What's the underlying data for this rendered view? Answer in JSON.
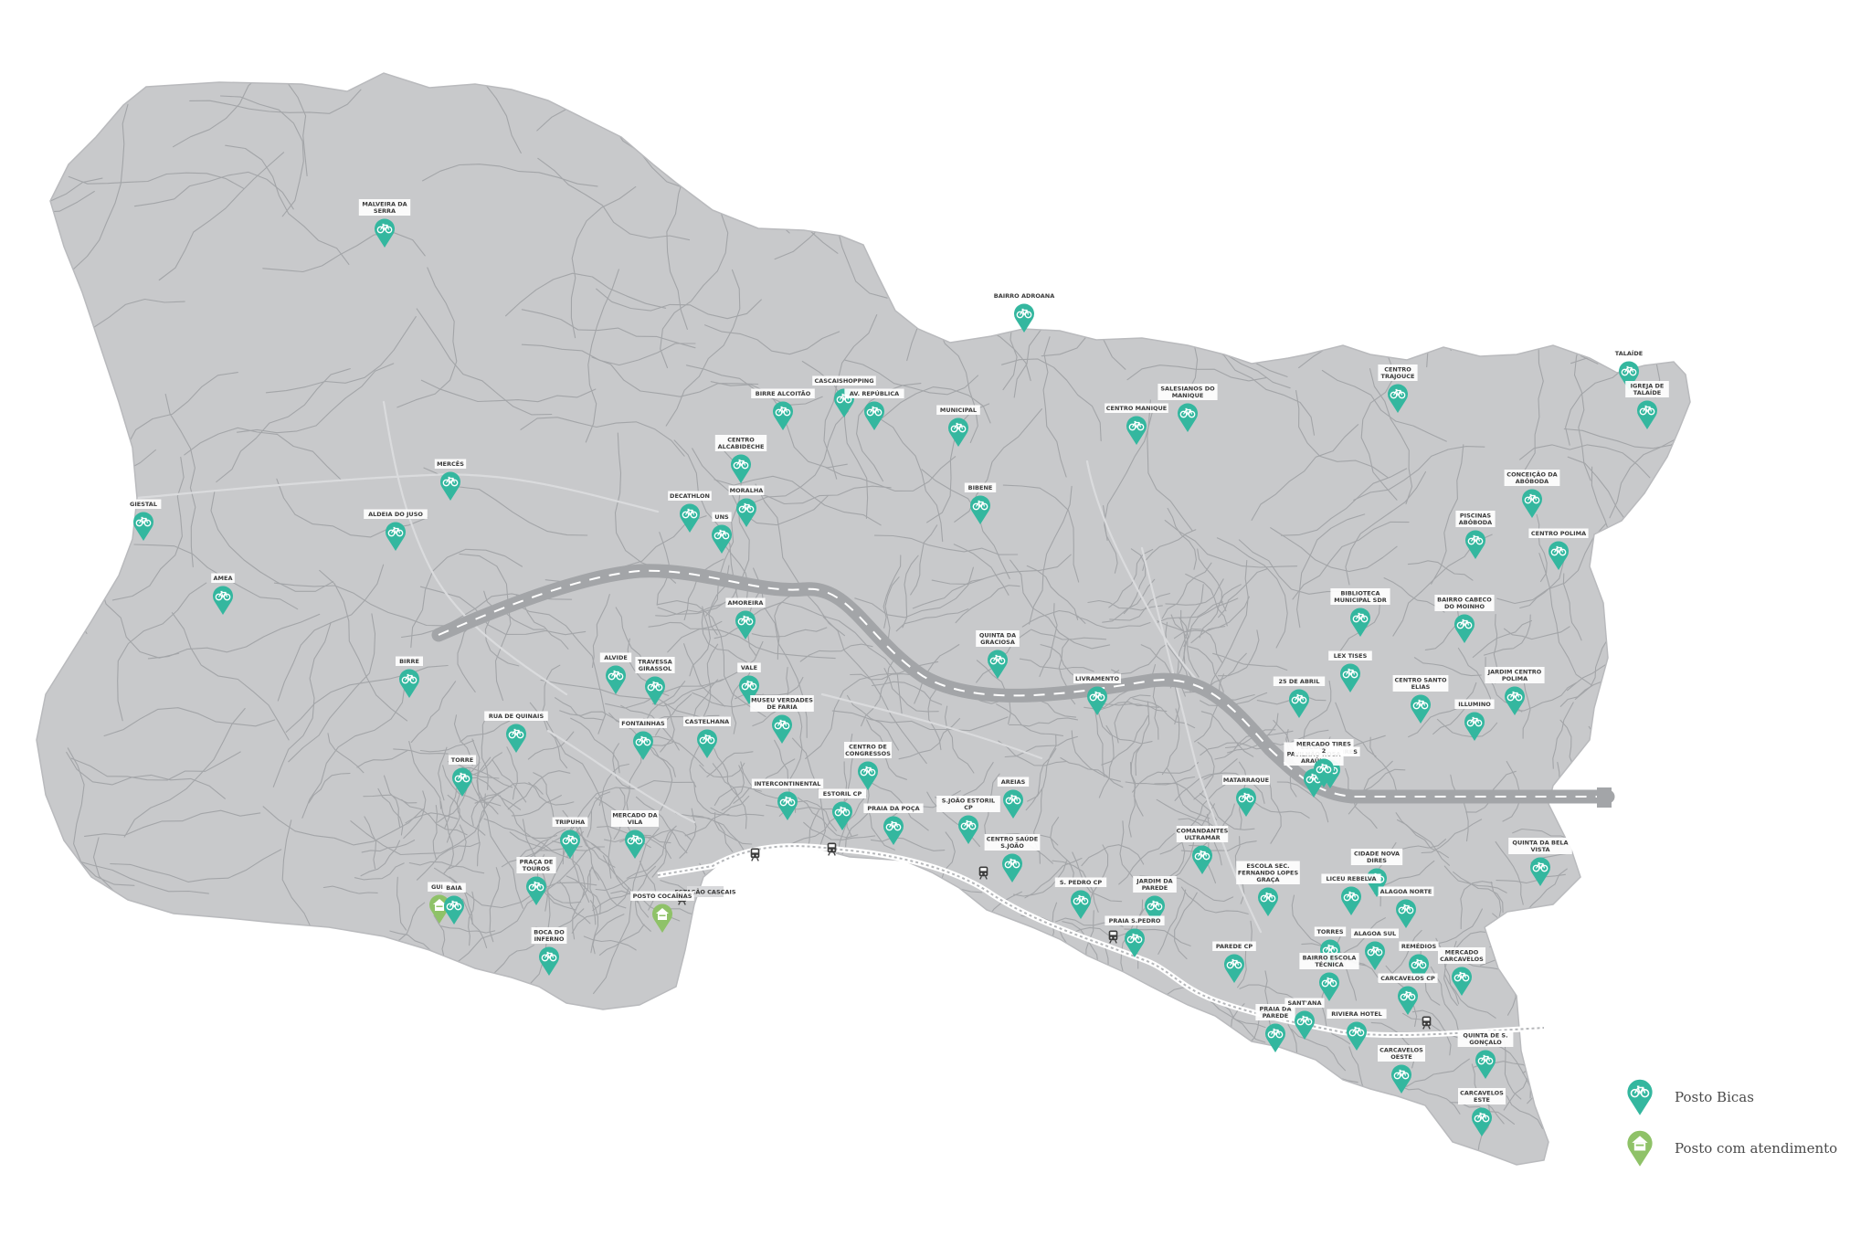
{
  "colors": {
    "land": "#c8c9cb",
    "roads": "#a3a5a8",
    "minor_roads": "#b2b4b7",
    "highway": "#9d9fa2",
    "highway_dash": "#ffffff",
    "bicas_pin": "#34b79f",
    "service_pin": "#8fc268",
    "background": "#ffffff"
  },
  "legend": {
    "bicas_label": "Posto Bicas",
    "bicas_icon": "bicycle-pin-icon",
    "service_label": "Posto com atendimento",
    "service_icon": "house-pin-icon"
  },
  "station_labels": {
    "cp": "ESTAÇÃO CASCAIS"
  },
  "stations": [
    {
      "name": "MALVEIRA DA SERRA",
      "type": "bicas"
    },
    {
      "name": "BAIRRO ADROANA",
      "type": "bicas"
    },
    {
      "name": "TALAÍDE",
      "type": "bicas"
    },
    {
      "name": "CENTRO TRAJOUCE",
      "type": "bicas"
    },
    {
      "name": "IGREJA DE TALAÍDE",
      "type": "bicas"
    },
    {
      "name": "CASCAISHOPPING",
      "type": "bicas"
    },
    {
      "name": "BIRRE ALCOITÃO",
      "type": "bicas"
    },
    {
      "name": "AV. REPÚBLICA",
      "type": "bicas"
    },
    {
      "name": "MUNICIPAL",
      "type": "bicas"
    },
    {
      "name": "CENTRO MANIQUE",
      "type": "bicas"
    },
    {
      "name": "SALESIANOS DO MANIQUE",
      "type": "bicas"
    },
    {
      "name": "CENTRO ALCABIDECHE",
      "type": "bicas"
    },
    {
      "name": "MERCÊS",
      "type": "bicas"
    },
    {
      "name": "CONCEIÇÃO DA ABÓBODA",
      "type": "bicas"
    },
    {
      "name": "GIESTAL",
      "type": "bicas"
    },
    {
      "name": "ALDEIA DO JUSO",
      "type": "bicas"
    },
    {
      "name": "DECATHLON",
      "type": "bicas"
    },
    {
      "name": "MORALHA",
      "type": "bicas"
    },
    {
      "name": "BIBENE",
      "type": "bicas"
    },
    {
      "name": "PISCINAS ABÓBODA",
      "type": "bicas"
    },
    {
      "name": "CENTRO POLIMA",
      "type": "bicas"
    },
    {
      "name": "UNS",
      "type": "bicas"
    },
    {
      "name": "AMEA",
      "type": "bicas"
    },
    {
      "name": "BIBLIOTECA MUNICIPAL SDR",
      "type": "bicas"
    },
    {
      "name": "BAIRRO CABECO DO MOINHO",
      "type": "bicas"
    },
    {
      "name": "AMOREIRA",
      "type": "bicas"
    },
    {
      "name": "QUINTA DA GRACIOSA",
      "type": "bicas"
    },
    {
      "name": "BIRRE",
      "type": "bicas"
    },
    {
      "name": "ALVIDE",
      "type": "bicas"
    },
    {
      "name": "TRAVESSA GIRASSOL",
      "type": "bicas"
    },
    {
      "name": "VALE",
      "type": "bicas"
    },
    {
      "name": "LIVRAMENTO",
      "type": "bicas"
    },
    {
      "name": "25 DE ABRIL",
      "type": "bicas"
    },
    {
      "name": "LEX TISES",
      "type": "bicas"
    },
    {
      "name": "CENTRO SANTO ELIAS",
      "type": "bicas"
    },
    {
      "name": "JARDIM CENTRO POLIMA",
      "type": "bicas"
    },
    {
      "name": "ILLUMINO",
      "type": "bicas"
    },
    {
      "name": "RUA DE QUINAIS",
      "type": "bicas"
    },
    {
      "name": "CASTELHANA",
      "type": "bicas"
    },
    {
      "name": "MUSEU VERDADES DE FARIA",
      "type": "bicas"
    },
    {
      "name": "FONTAINHAS",
      "type": "bicas"
    },
    {
      "name": "CENTRO DE CONGRESSOS",
      "type": "bicas"
    },
    {
      "name": "MERCADO TIRES",
      "type": "bicas"
    },
    {
      "name": "ESCOLA PAVILHÃO ROSA ARAÚJO",
      "type": "bicas"
    },
    {
      "name": "TORRE",
      "type": "bicas"
    },
    {
      "name": "AREIAS",
      "type": "bicas"
    },
    {
      "name": "MATARRAQUE",
      "type": "bicas"
    },
    {
      "name": "INTERCONTINENTAL",
      "type": "bicas"
    },
    {
      "name": "ESTORIL CP",
      "type": "bicas"
    },
    {
      "name": "PRAIA DA POÇA",
      "type": "bicas"
    },
    {
      "name": "S.JOÃO ESTORIL CP",
      "type": "bicas"
    },
    {
      "name": "TRIPUHA",
      "type": "bicas"
    },
    {
      "name": "MERCADO DA VILA",
      "type": "bicas"
    },
    {
      "name": "CENTRO SAÚDE S.JOÃO",
      "type": "bicas"
    },
    {
      "name": "COMANDANTES ULTRAMAR",
      "type": "bicas"
    },
    {
      "name": "QUINTA DA BELA VISTA",
      "type": "bicas"
    },
    {
      "name": "CIDADE NOVA DIRES",
      "type": "bicas"
    },
    {
      "name": "PRAÇA DE TOUROS",
      "type": "bicas"
    },
    {
      "name": "GUIA",
      "type": "service"
    },
    {
      "name": "POSTO COCAÍNAS",
      "type": "service"
    },
    {
      "name": "BAIA",
      "type": "bicas"
    },
    {
      "name": "S. PEDRO CP",
      "type": "bicas"
    },
    {
      "name": "JARDIM DA PAREDE",
      "type": "bicas"
    },
    {
      "name": "ESCOLA SEC. FERNANDO LOPES GRAÇA",
      "type": "bicas"
    },
    {
      "name": "LICEU REBELVA",
      "type": "bicas"
    },
    {
      "name": "ALAGOA NORTE",
      "type": "bicas"
    },
    {
      "name": "BOCA DO INFERNO",
      "type": "bicas"
    },
    {
      "name": "PRAIA S.PEDRO",
      "type": "bicas"
    },
    {
      "name": "PAREDE CP",
      "type": "bicas"
    },
    {
      "name": "TORRES",
      "type": "bicas"
    },
    {
      "name": "ALAGOA SUL",
      "type": "bicas"
    },
    {
      "name": "REMÉDIOS",
      "type": "bicas"
    },
    {
      "name": "MERCADO CARCAVELOS",
      "type": "bicas"
    },
    {
      "name": "BAIRRO ESCOLA TÉCNICA",
      "type": "bicas"
    },
    {
      "name": "CARCAVELOS CP",
      "type": "bicas"
    },
    {
      "name": "PRAIA DA PAREDE",
      "type": "bicas"
    },
    {
      "name": "SANT'ANA",
      "type": "bicas"
    },
    {
      "name": "RIVIERA HOTEL",
      "type": "bicas"
    },
    {
      "name": "QUINTA DE S. GONÇALO",
      "type": "bicas"
    },
    {
      "name": "CARCAVELOS OESTE",
      "type": "bicas"
    },
    {
      "name": "CARCAVELOS ESTE",
      "type": "bicas"
    },
    {
      "name": "MERCADO TIRES 2",
      "type": "bicas"
    }
  ]
}
